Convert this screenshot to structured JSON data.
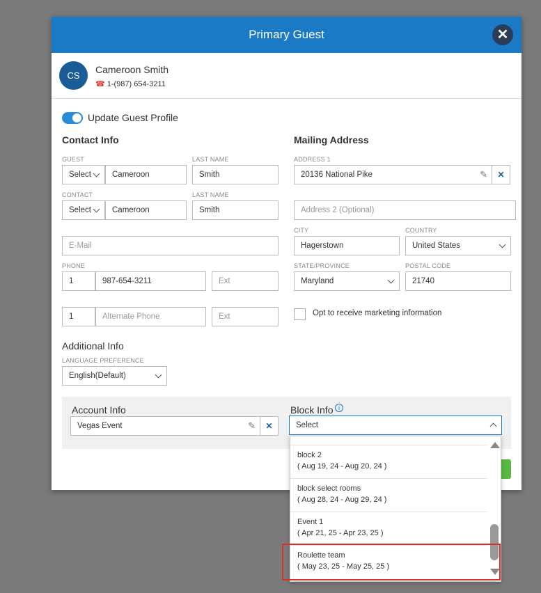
{
  "modal": {
    "title": "Primary Guest",
    "close_icon": "close-icon"
  },
  "guest": {
    "initials": "CS",
    "name": "Cameroon Smith",
    "phone": "1-(987) 654-3211",
    "phone_icon": "phone-icon"
  },
  "toggle": {
    "label": "Update Guest Profile",
    "on": true,
    "color": "#2b8bd6"
  },
  "contact": {
    "title": "Contact Info",
    "guest_label": "GUEST",
    "guest_prefix": "Select",
    "guest_first": "Cameroon",
    "last_name_label": "LAST NAME",
    "guest_last": "Smith",
    "contact_label": "CONTACT",
    "contact_prefix": "Select",
    "contact_first": "Cameroon",
    "contact_last_label": "LAST NAME",
    "contact_last": "Smith",
    "email_placeholder": "E-Mail",
    "phone_label": "PHONE",
    "phone_cc": "1",
    "phone_number": "987-654-3211",
    "phone_ext_placeholder": "Ext",
    "alt_cc": "1",
    "alt_placeholder": "Alternate Phone",
    "alt_ext_placeholder": "Ext"
  },
  "mailing": {
    "title": "Mailing Address",
    "address1_label": "ADDRESS 1",
    "address1": "20136 National Pike",
    "address2_placeholder": "Address 2 (Optional)",
    "city_label": "CITY",
    "city": "Hagerstown",
    "country_label": "COUNTRY",
    "country": "United States",
    "state_label": "STATE/PROVINCE",
    "state": "Maryland",
    "postal_label": "POSTAL CODE",
    "postal": "21740",
    "marketing_label": "Opt to receive marketing information"
  },
  "additional": {
    "title": "Additional Info",
    "language_label": "LANGUAGE PREFERENCE",
    "language": "English(Default)"
  },
  "account": {
    "title": "Account Info",
    "value": "Vegas Event"
  },
  "block": {
    "title": "Block Info",
    "info_icon": "info-icon",
    "selected": "Select",
    "options": [
      {
        "name": "block 2",
        "dates": "( Aug 19, 24 - Aug 20, 24 )"
      },
      {
        "name": "block select rooms",
        "dates": "( Aug 28, 24 - Aug 29, 24 )"
      },
      {
        "name": "Event 1",
        "dates": "( Apr 21, 25 - Apr 23, 25 )"
      },
      {
        "name": "Roulette team",
        "dates": "( May 23, 25 - May 25, 25 )"
      }
    ]
  },
  "colors": {
    "header": "#1a7ac6",
    "avatar": "#1a5c95",
    "highlight": "#d9302a",
    "save": "#59b845"
  }
}
